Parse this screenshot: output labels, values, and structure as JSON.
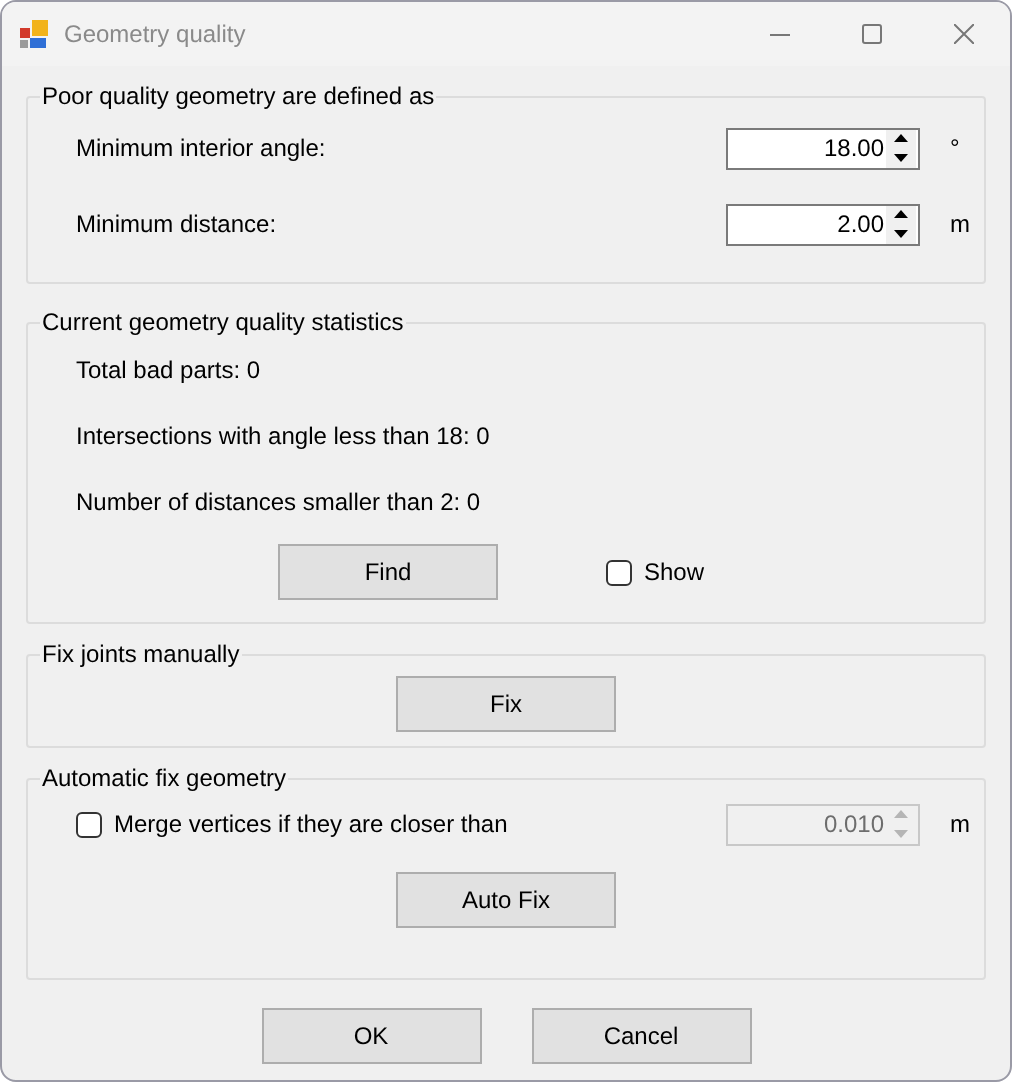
{
  "window": {
    "title": "Geometry quality"
  },
  "definition": {
    "title": "Poor quality geometry are defined as",
    "fields": [
      {
        "label": "Minimum interior angle:",
        "value": "18.00",
        "unit": "°"
      },
      {
        "label": "Minimum distance:",
        "value": "2.00",
        "unit": "m"
      }
    ]
  },
  "statistics": {
    "title": "Current geometry quality statistics",
    "lines": [
      "Total bad parts: 0",
      "Intersections with angle less than 18: 0",
      "Number of distances smaller than 2: 0"
    ],
    "find_button": "Find",
    "show": {
      "label": "Show",
      "checked": false
    }
  },
  "manual_fix": {
    "title": "Fix joints manually",
    "button": "Fix"
  },
  "auto_fix": {
    "title": "Automatic fix geometry",
    "merge": {
      "label": "Merge vertices if they are closer than",
      "checked": false,
      "value": "0.010",
      "unit": "m",
      "disabled": true
    },
    "button": "Auto Fix"
  },
  "buttons": [
    "OK",
    "Cancel"
  ]
}
